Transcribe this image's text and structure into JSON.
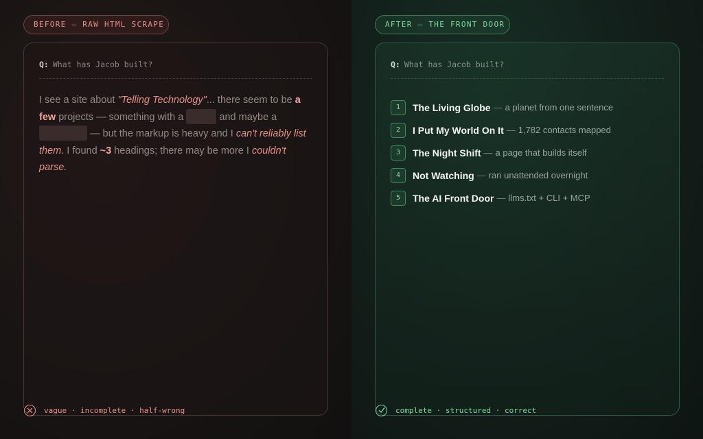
{
  "before": {
    "pill_label": "BEFORE — RAW HTML SCRAPE",
    "question_prefix": "Q:",
    "question": "What has Jacob built?",
    "answer": {
      "p1": "I see a site about ",
      "site_name": "\"Telling Technology\"",
      "p2": "... there seem to be ",
      "few": "a few",
      "p3": " projects — something with a ",
      "p4": " and maybe a ",
      "p5": " — but the markup is heavy and I ",
      "cant_list": "can't reliably list them.",
      "p6": " I found ",
      "count": "~3",
      "p7": " headings; there may be more I ",
      "couldnt": "couldn't parse.",
      "p8": ""
    },
    "footer": "vague · incomplete · half-wrong",
    "accent_color": "#e8908a"
  },
  "after": {
    "pill_label": "AFTER — THE FRONT DOOR",
    "question_prefix": "Q:",
    "question": "What has Jacob built?",
    "separator": "—",
    "items": [
      {
        "num": "1",
        "title": "The Living Globe",
        "desc": "a planet from one sentence"
      },
      {
        "num": "2",
        "title": "I Put My World On It",
        "desc": "1,782 contacts mapped"
      },
      {
        "num": "3",
        "title": "The Night Shift",
        "desc": "a page that builds itself"
      },
      {
        "num": "4",
        "title": "Not Watching",
        "desc": "ran unattended overnight"
      },
      {
        "num": "5",
        "title": "The AI Front Door",
        "desc": "llms.txt + CLI + MCP"
      }
    ],
    "footer": "complete · structured · correct",
    "accent_color": "#7fd8a0"
  },
  "icons": {
    "before_footer": "x-circle-icon",
    "after_footer": "check-circle-icon"
  }
}
